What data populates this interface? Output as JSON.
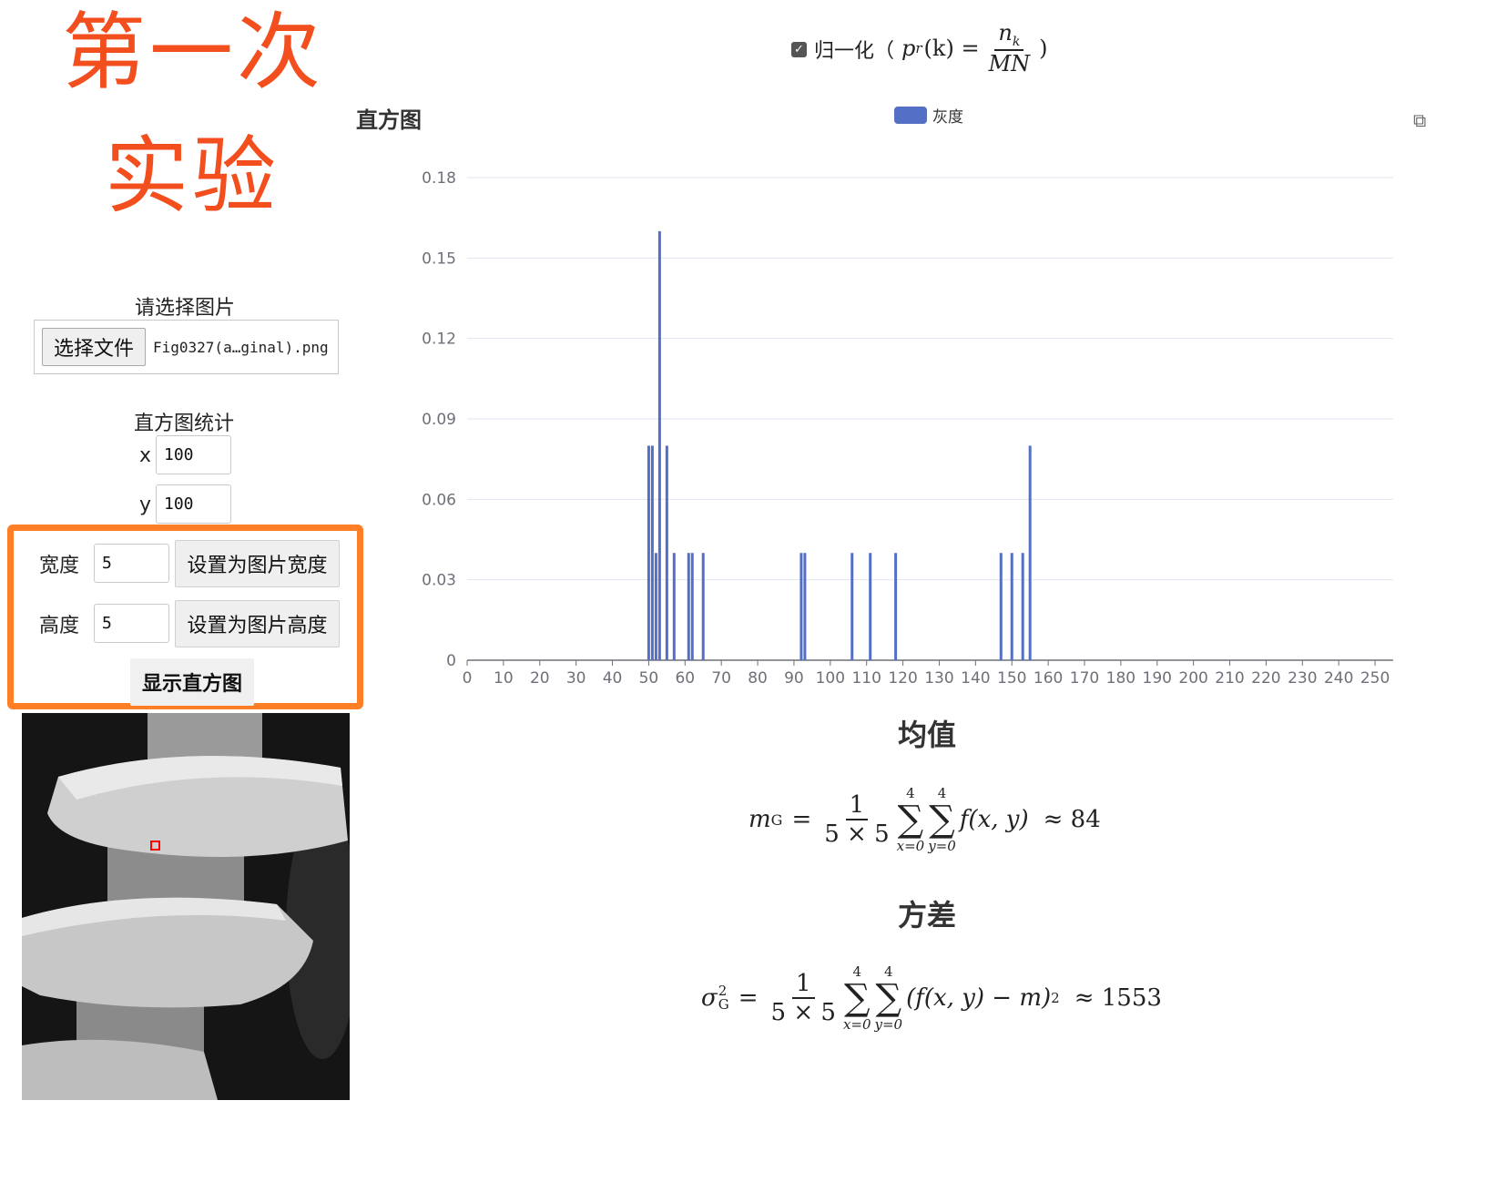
{
  "title": {
    "line1": "第一次",
    "line2": "实验"
  },
  "file": {
    "prompt": "请选择图片",
    "button": "选择文件",
    "filename": "Fig0327(a…ginal).png"
  },
  "stats": {
    "heading": "直方图统计",
    "x_label": "x",
    "x_value": "100",
    "y_label": "y",
    "y_value": "100"
  },
  "size": {
    "width_label": "宽度",
    "width_value": "5",
    "set_width_button": "设置为图片宽度",
    "height_label": "高度",
    "height_value": "5",
    "set_height_button": "设置为图片高度",
    "show_button": "显示直方图"
  },
  "normalize": {
    "checked": true,
    "label": "归一化（",
    "formula_lhs": "p",
    "formula_sub": "r",
    "formula_arg": "(k) =",
    "num": "n",
    "num_sub": "k",
    "den": "MN",
    "close": ")"
  },
  "chart_title": "直方图",
  "legend_label": "灰度",
  "colors": {
    "accent": "#f24e1e",
    "frame": "#ff7f27",
    "bar": "#5470c6"
  },
  "chart_data": {
    "type": "bar",
    "title": "直方图",
    "series": [
      {
        "name": "灰度",
        "values": [
          [
            50,
            0.08
          ],
          [
            51,
            0.08
          ],
          [
            52,
            0.04
          ],
          [
            53,
            0.16
          ],
          [
            55,
            0.08
          ],
          [
            57,
            0.04
          ],
          [
            61,
            0.04
          ],
          [
            62,
            0.04
          ],
          [
            65,
            0.04
          ],
          [
            92,
            0.04
          ],
          [
            93,
            0.04
          ],
          [
            106,
            0.04
          ],
          [
            111,
            0.04
          ],
          [
            118,
            0.04
          ],
          [
            147,
            0.04
          ],
          [
            150,
            0.04
          ],
          [
            153,
            0.04
          ],
          [
            155,
            0.08
          ]
        ]
      }
    ],
    "x_ticks": [
      "0",
      "10",
      "20",
      "30",
      "40",
      "50",
      "60",
      "70",
      "80",
      "90",
      "100",
      "110",
      "120",
      "130",
      "140",
      "150",
      "160",
      "170",
      "180",
      "190",
      "200",
      "210",
      "220",
      "230",
      "240",
      "250"
    ],
    "y_ticks": [
      "0",
      "0.03",
      "0.06",
      "0.09",
      "0.12",
      "0.15",
      "0.18"
    ],
    "xlim": [
      0,
      255
    ],
    "ylim": [
      0,
      0.18
    ],
    "grid": true,
    "legend_position": "top"
  },
  "mean": {
    "heading": "均值",
    "lhs": "m",
    "lhs_sub": "G",
    "frac_num": "1",
    "frac_den": "5 × 5",
    "sum1_top": "4",
    "sum1_bot": "x=0",
    "sum2_top": "4",
    "sum2_bot": "y=0",
    "body": "f(x, y)",
    "result": "≈ 84"
  },
  "variance": {
    "heading": "方差",
    "lhs": "σ",
    "lhs_sup": "2",
    "lhs_sub": "G",
    "frac_num": "1",
    "frac_den": "5 × 5",
    "sum1_top": "4",
    "sum1_bot": "x=0",
    "sum2_top": "4",
    "sum2_bot": "y=0",
    "body": "(f(x, y) − m)",
    "body_sup": "2",
    "result": "≈ 1553"
  }
}
